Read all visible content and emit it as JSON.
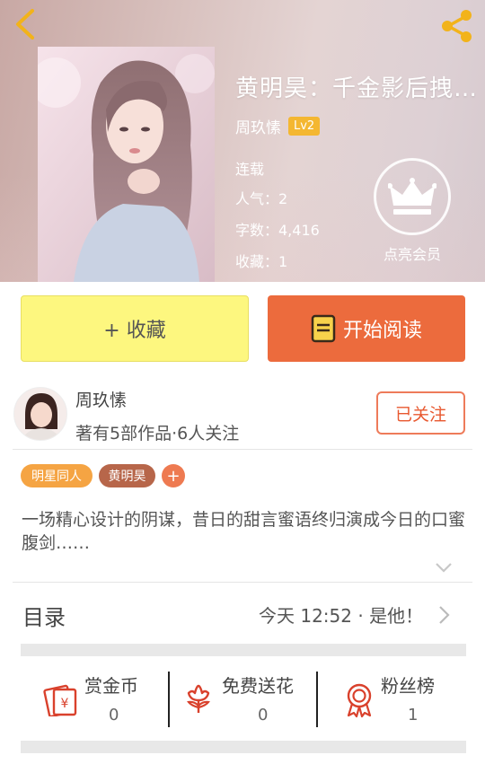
{
  "header": {
    "title": "黄明昊：千金影后拽…",
    "author": "周玖愫",
    "level": "Lv2",
    "status": "连载",
    "popularity": "人气：2",
    "word_count": "字数：4,416",
    "favorites": "收藏：1",
    "vip_label": "点亮会员"
  },
  "actions": {
    "collect_label": "+ 收藏",
    "read_label": "开始阅读"
  },
  "author_card": {
    "name": "周玖愫",
    "meta": "著有5部作品·6人关注",
    "follow_label": "已关注"
  },
  "tags": [
    "明星同人",
    "黄明昊"
  ],
  "tag_add": "+",
  "description": "一场精心设计的阴谋，昔日的甜言蜜语终归演成今日的口蜜腹剑……",
  "catalog": {
    "title": "目录",
    "latest": "今天 12:52 · 是他！"
  },
  "stats": [
    {
      "label": "赏金币",
      "value": "0",
      "icon": "reward-coin-icon"
    },
    {
      "label": "免费送花",
      "value": "0",
      "icon": "flower-icon"
    },
    {
      "label": "粉丝榜",
      "value": "1",
      "icon": "medal-icon"
    }
  ],
  "colors": {
    "accent_orange": "#ec6b3d",
    "collect_yellow": "#fdf77f",
    "level_badge": "#f4b731",
    "tag_orange": "#f5a443",
    "tag_brown": "#b7664a"
  }
}
